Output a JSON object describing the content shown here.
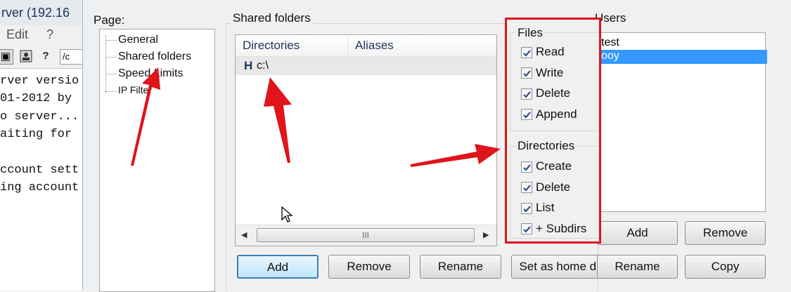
{
  "background": {
    "title": "rver (192.16",
    "menu": [
      "Edit",
      "?"
    ],
    "toolbar_path": "/c",
    "console_lines": [
      "rver versio",
      "01-2012 by",
      "o server...",
      "aiting for",
      "",
      "ccount sett",
      "ing account"
    ]
  },
  "page_panel": {
    "label": "Page:",
    "items": [
      "General",
      "Shared folders",
      "Speed Limits",
      "IP Filter"
    ]
  },
  "shared_folders": {
    "title": "Shared folders",
    "columns": [
      "Directories",
      "Aliases"
    ],
    "rows": [
      {
        "prefix": "H",
        "dir": "c:\\",
        "alias": ""
      }
    ],
    "scroll_thumb": "III",
    "buttons": {
      "add": "Add",
      "remove": "Remove",
      "rename": "Rename",
      "home": "Set as home dir"
    }
  },
  "files": {
    "title": "Files",
    "items": [
      {
        "label": "Read",
        "checked": true
      },
      {
        "label": "Write",
        "checked": true
      },
      {
        "label": "Delete",
        "checked": true
      },
      {
        "label": "Append",
        "checked": true
      }
    ]
  },
  "directories": {
    "title": "Directories",
    "items": [
      {
        "label": "Create",
        "checked": true
      },
      {
        "label": "Delete",
        "checked": true
      },
      {
        "label": "List",
        "checked": true
      },
      {
        "label": "+ Subdirs",
        "checked": true
      }
    ]
  },
  "users": {
    "title": "Users",
    "items": [
      "test",
      "ooy"
    ],
    "selected_index": 1,
    "buttons": {
      "add": "Add",
      "remove": "Remove",
      "rename": "Rename",
      "copy": "Copy"
    }
  },
  "colors": {
    "highlight": "#3399ff",
    "annotation": "#e0141a"
  }
}
